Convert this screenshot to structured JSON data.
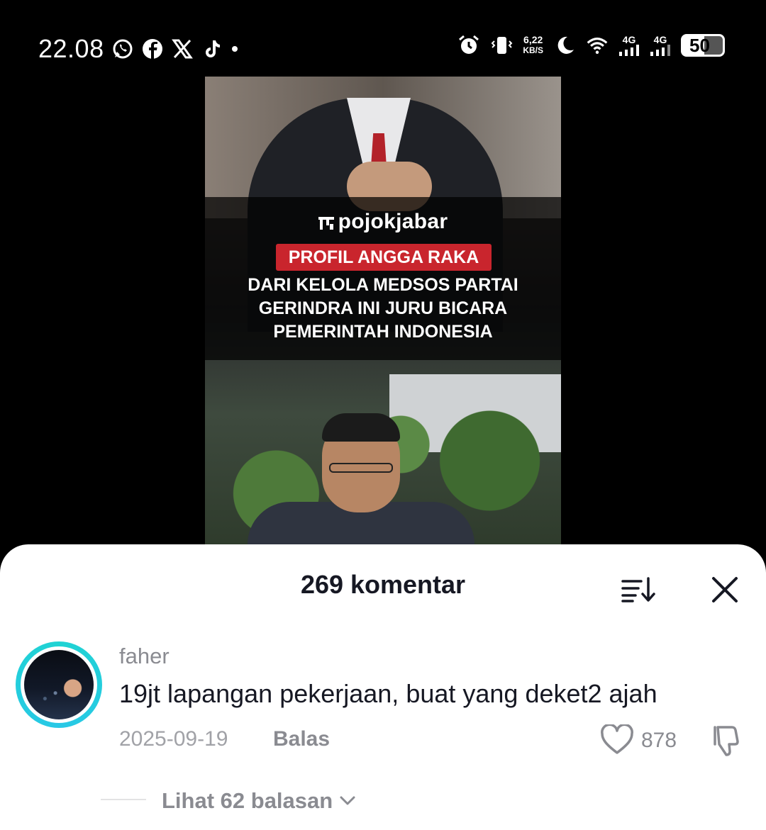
{
  "status_bar": {
    "time": "22.08",
    "net_speed_value": "6,22",
    "net_speed_unit": "KB/S",
    "sim1_label": "4G",
    "sim2_label": "4G",
    "battery_level": "50",
    "left_icons": [
      "whatsapp-icon",
      "facebook-icon",
      "x-icon",
      "tiktok-icon",
      "more-notifications-dot"
    ],
    "right_icons": [
      "alarm-icon",
      "vibrate-icon",
      "dnd-moon-icon",
      "wifi-icon",
      "signal-icon",
      "signal-icon",
      "battery-icon"
    ]
  },
  "video": {
    "brand": "pojokjabar",
    "tag": "PROFIL ANGGA RAKA",
    "headline_lines": [
      "DARI KELOLA MEDSOS PARTAI",
      "GERINDRA INI JURU BICARA",
      "PEMERINTAH INDONESIA"
    ]
  },
  "comments_sheet": {
    "title": "269 komentar",
    "comment": {
      "username": "faher",
      "text": "19jt lapangan pekerjaan, buat yang deket2 ajah",
      "date": "2025-09-19",
      "reply_label": "Balas",
      "like_count": "878",
      "view_replies_label": "Lihat 62 balasan"
    }
  },
  "colors": {
    "accent_ring": "#1fd3d3",
    "tag_red": "#c9252d",
    "text_primary": "#161823",
    "text_secondary": "#8a8b91"
  }
}
